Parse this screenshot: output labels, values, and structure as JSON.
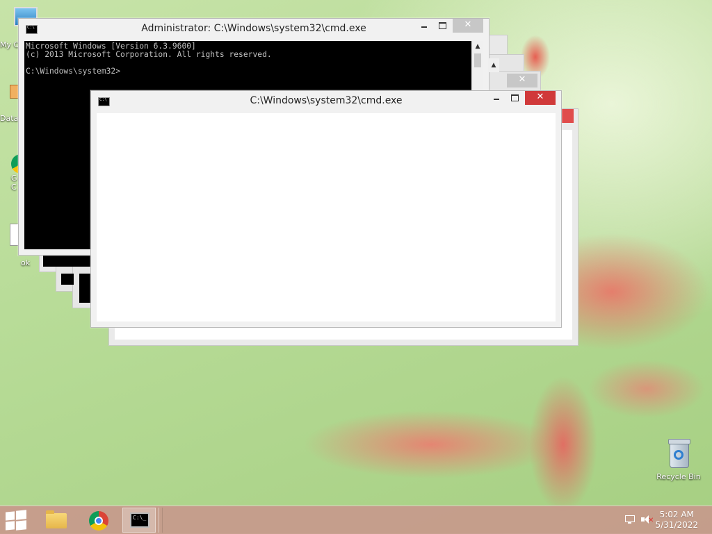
{
  "desktop": {
    "icons_left": [
      {
        "label": "My C"
      },
      {
        "label": "Data"
      },
      {
        "label": "G"
      },
      {
        "label": "C"
      },
      {
        "label": "ok"
      }
    ],
    "recycle_bin": {
      "label": "Recycle Bin",
      "icon": "recycle-bin-icon"
    }
  },
  "admin_window": {
    "title": "Administrator: C:\\Windows\\system32\\cmd.exe",
    "icon": "cmd-icon",
    "console_text": "Microsoft Windows [Version 6.3.9600]\n(c) 2013 Microsoft Corporation. All rights reserved.\n\nC:\\Windows\\system32>",
    "buttons": {
      "minimize": "minimize-icon",
      "maximize": "maximize-icon",
      "close": "✕"
    }
  },
  "front_window": {
    "title": "C:\\Windows\\system32\\cmd.exe",
    "icon": "cmd-icon",
    "buttons": {
      "minimize": "minimize-icon",
      "maximize": "maximize-icon",
      "close": "✕"
    }
  },
  "ghost_windows": {
    "close_label": "✕"
  },
  "taskbar": {
    "items": [
      "windows-start-icon",
      "file-explorer-icon",
      "chrome-icon",
      "cmd-icon"
    ],
    "clock_time": "5:02 AM",
    "clock_date": "5/31/2022",
    "tray_icons": [
      "network-icon",
      "volume-muted-icon"
    ]
  },
  "colors": {
    "close_red": "#d0393a",
    "console_bg": "#000000",
    "taskbar": "#c8968c"
  }
}
